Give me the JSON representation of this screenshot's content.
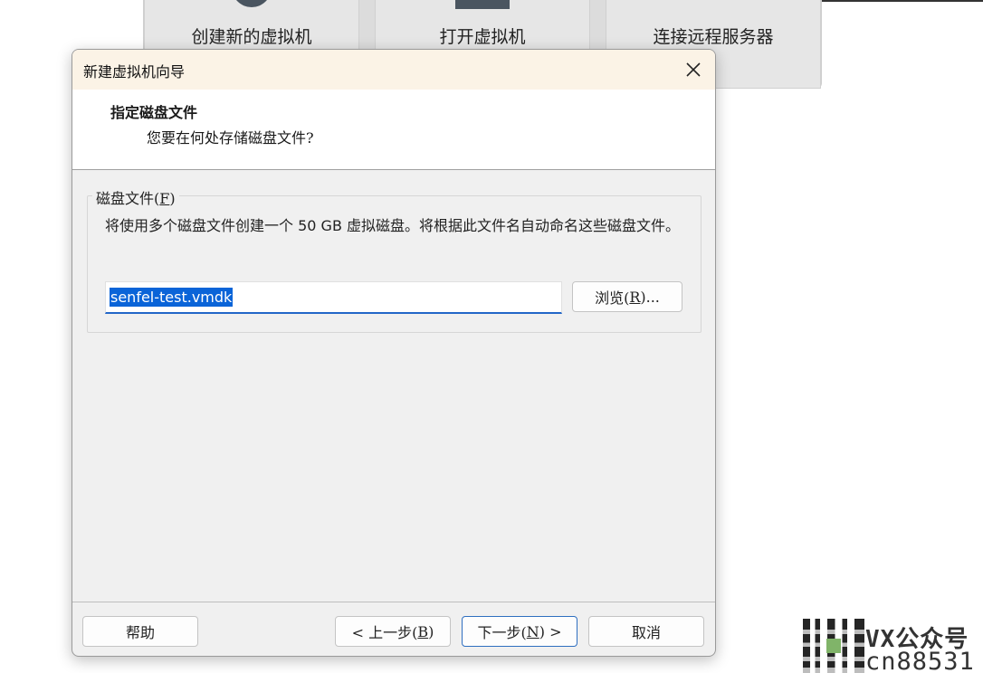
{
  "background": {
    "tiles": [
      {
        "label": "创建新的虚拟机"
      },
      {
        "label": "打开虚拟机"
      },
      {
        "label": "连接远程服务器"
      }
    ]
  },
  "dialog": {
    "title": "新建虚拟机向导",
    "close_icon": "close-icon",
    "header": {
      "title": "指定磁盘文件",
      "subtitle": "您要在何处存储磁盘文件?"
    },
    "disk_group": {
      "legend": "磁盘文件(",
      "legend_mnemonic": "F",
      "legend_end": ")",
      "description_before": "将使用多个磁盘文件创建一个 ",
      "description_size": "50 GB",
      "description_after": " 虚拟磁盘。将根据此文件名自动命名这些磁盘文件。",
      "file_name": "senfel-test.vmdk",
      "browse": {
        "label": "浏览(",
        "mnemonic": "R",
        "end": ")..."
      }
    },
    "buttons": {
      "help": "帮助",
      "back": {
        "label": "< 上一步(",
        "mnemonic": "B",
        "end": ")"
      },
      "next": {
        "label": "下一步(",
        "mnemonic": "N",
        "end": ") >"
      },
      "cancel": "取消"
    }
  },
  "watermark": {
    "line1": "VX公众号",
    "line2": "cn88531"
  },
  "colors": {
    "accent": "#0a64d8",
    "titlebar": "#fbf3e6",
    "dialog_bg": "#f0f0f0"
  }
}
